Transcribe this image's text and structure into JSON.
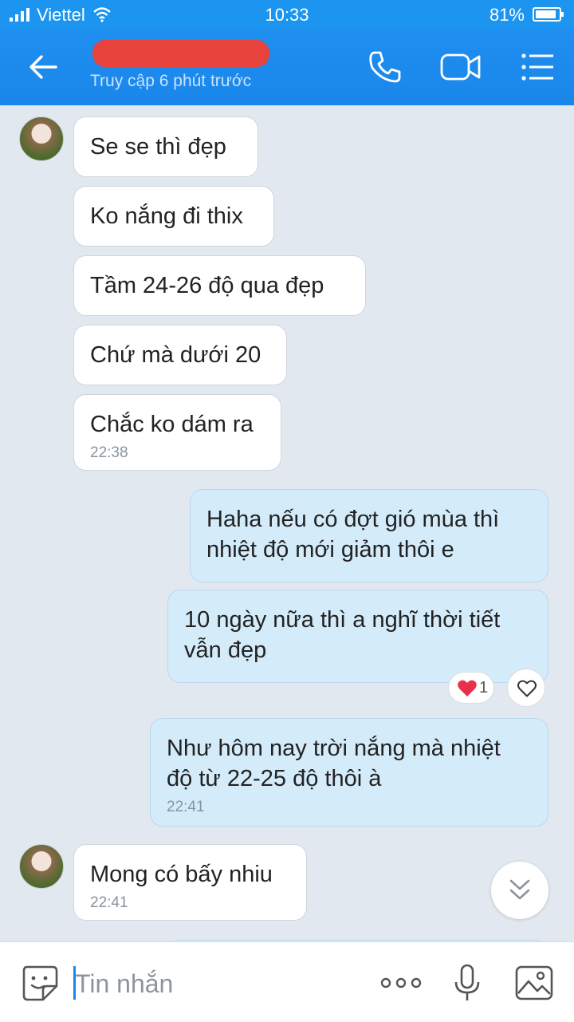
{
  "status_bar": {
    "carrier": "Viettel",
    "time": "10:33",
    "battery": "81%"
  },
  "header": {
    "contact_name": "",
    "last_seen": "Truy cập 6 phút trước",
    "icons": [
      "back-arrow-icon",
      "phone-icon",
      "video-call-icon",
      "menu-icon"
    ]
  },
  "messages": [
    {
      "from": "them",
      "text": "Se se thì đẹp"
    },
    {
      "from": "them",
      "text": "Ko nắng đi thix"
    },
    {
      "from": "them",
      "text": "Tầm 24-26 độ qua đẹp"
    },
    {
      "from": "them",
      "text": "Chứ mà dưới 20"
    },
    {
      "from": "them",
      "text": "Chắc ko dám ra",
      "time": "22:38"
    },
    {
      "from": "me",
      "text": "Haha nếu có đợt gió mùa thì nhiệt độ mới giảm thôi e"
    },
    {
      "from": "me",
      "text": "10 ngày nữa thì a nghĩ thời tiết vẫn đẹp",
      "reaction": {
        "icon": "heart-icon",
        "count": "1"
      }
    },
    {
      "from": "me",
      "text": "Như hôm nay trời nắng mà nhiệt độ từ 22-25 độ thôi à",
      "time": "22:41"
    },
    {
      "from": "them",
      "text": "Mong có bấy nhiu",
      "time": "22:41"
    }
  ],
  "input_bar": {
    "placeholder": "Tin nhắn",
    "value": "",
    "icons": [
      "sticker-icon",
      "more-icon",
      "microphone-icon",
      "image-icon"
    ]
  },
  "colors": {
    "header_blue": "#1a86ea",
    "chat_background": "#e2e8ef",
    "outgoing_bubble": "#d4ebfa",
    "incoming_bubble": "#ffffff",
    "heart_red": "#e8304a"
  }
}
